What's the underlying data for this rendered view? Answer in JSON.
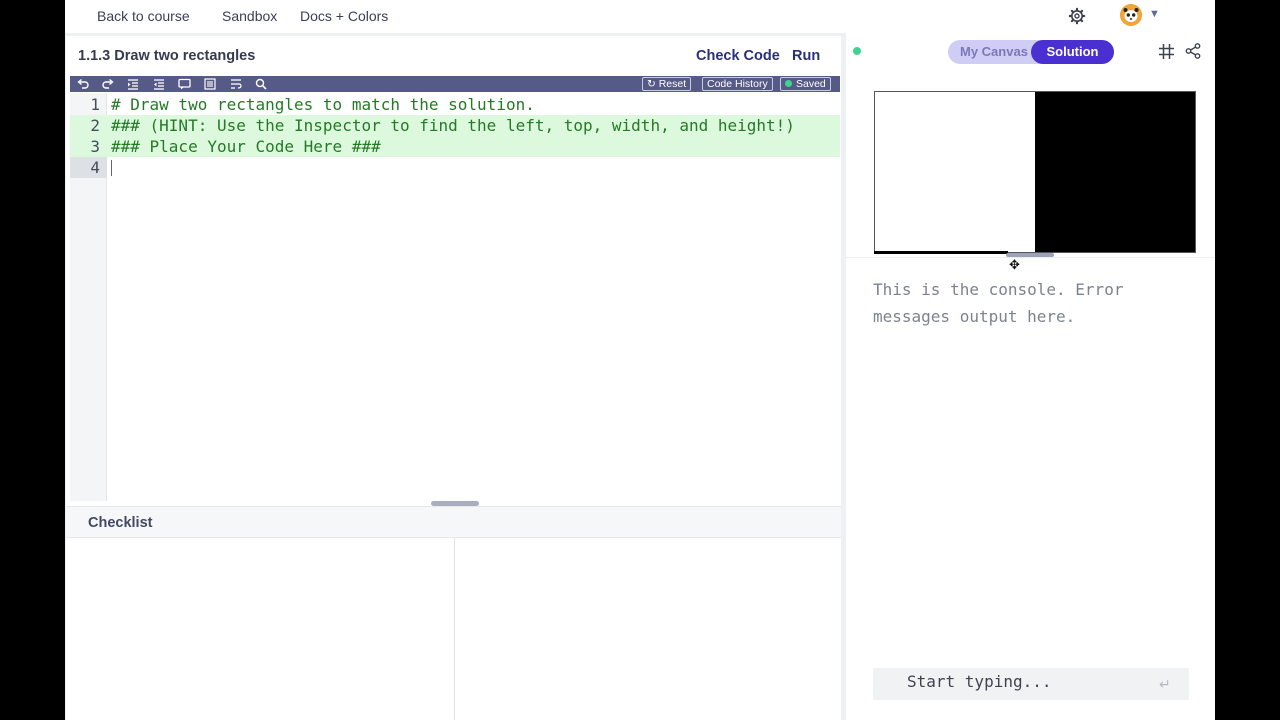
{
  "nav": {
    "back": "Back to course",
    "sandbox": "Sandbox",
    "docs": "Docs + Colors",
    "settings_icon": "gear-icon",
    "avatar_icon": "avatar"
  },
  "exercise": {
    "title": "1.1.3 Draw two rectangles",
    "check_code": "Check Code",
    "run": "Run"
  },
  "toolbar": {
    "icons": [
      "undo-icon",
      "redo-icon",
      "indent-icon",
      "outdent-icon",
      "comment-icon",
      "format-icon",
      "wrap-icon",
      "search-icon"
    ],
    "reset": "Reset",
    "history": "Code History",
    "saved": "Saved"
  },
  "editor": {
    "lines": [
      {
        "num": "1",
        "text": "# Draw two rectangles to match the solution.",
        "highlight": false
      },
      {
        "num": "2",
        "text": "### (HINT: Use the Inspector to find the left, top, width, and height!)",
        "highlight": true
      },
      {
        "num": "3",
        "text": "### Place Your Code Here ###",
        "highlight": true
      },
      {
        "num": "4",
        "text": "",
        "highlight": false
      }
    ]
  },
  "checklist": {
    "title": "Checklist"
  },
  "right": {
    "tab_mycanvas": "My Canvas",
    "tab_solution": "Solution",
    "console_message": "This is the console. Error messages output here.",
    "console_placeholder": "Start typing...",
    "colors": {
      "accent": "#4a2fd1",
      "toggle_bg": "#cfcdf6",
      "status": "#3ed490"
    }
  }
}
